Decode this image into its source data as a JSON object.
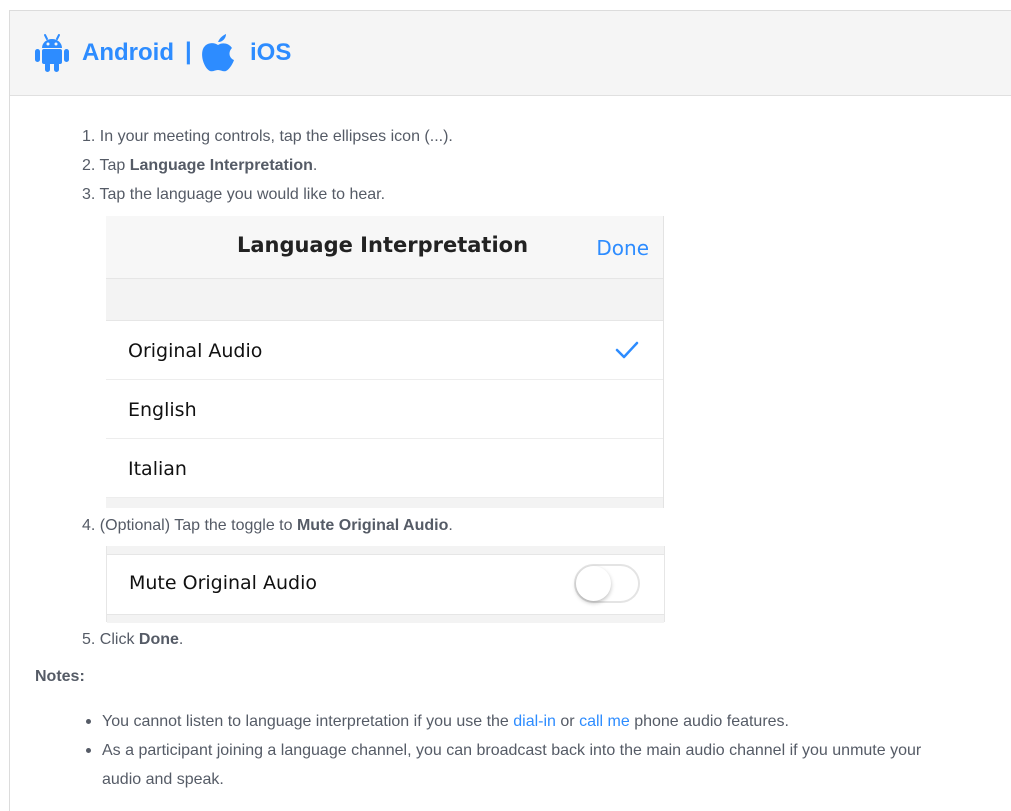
{
  "tabs": {
    "android_label": "Android",
    "separator": "|",
    "ios_label": "iOS",
    "android_icon": "android-icon",
    "apple_icon": "apple-icon"
  },
  "steps": [
    {
      "num": "1.",
      "text": "In your meeting controls, tap the ellipses icon (...)."
    },
    {
      "num": "2.",
      "pre": "Tap ",
      "bold": "Language Interpretation",
      "post": "."
    },
    {
      "num": "3.",
      "text": "Tap the language you would like to hear."
    },
    {
      "num": "4.",
      "pre": "(Optional) Tap the toggle to ",
      "bold": "Mute Original Audio",
      "post": "."
    },
    {
      "num": "5.",
      "pre": "Click ",
      "bold": "Done",
      "post": "."
    }
  ],
  "screenshot1": {
    "title": "Language Interpretation",
    "done_label": "Done",
    "rows": [
      {
        "label": "Original Audio",
        "selected": true
      },
      {
        "label": "English",
        "selected": false
      },
      {
        "label": "Italian",
        "selected": false
      }
    ]
  },
  "screenshot2": {
    "label": "Mute Original Audio",
    "toggle_on": false
  },
  "notes": {
    "heading": "Notes:",
    "bullet1": {
      "pre": "You cannot listen to language interpretation if you use the ",
      "link1": "dial-in",
      "mid": " or ",
      "link2": "call me",
      "post": " phone audio features."
    },
    "bullet2": "As a participant joining a language channel, you can broadcast back into the main audio channel if you unmute your audio and speak."
  },
  "colors": {
    "accent": "#2d8cff",
    "text": "#555b66"
  }
}
